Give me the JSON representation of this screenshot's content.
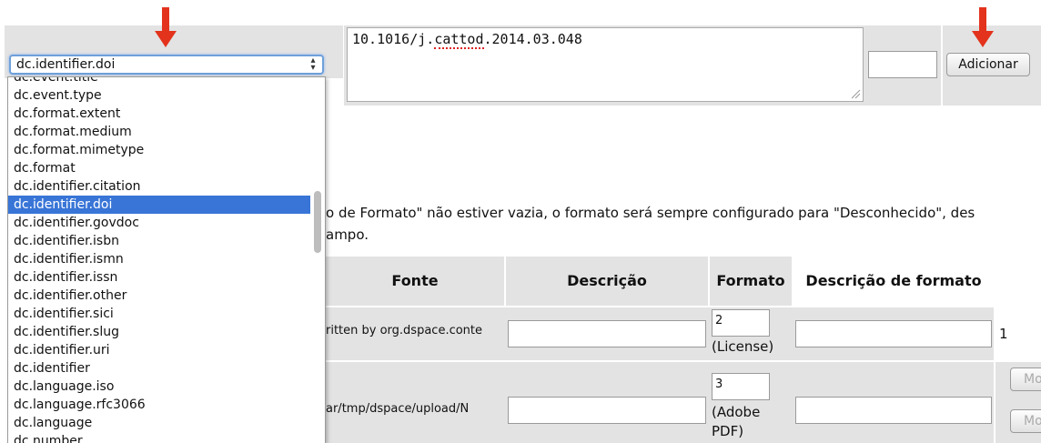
{
  "field_select": {
    "selected": "dc.identifier.doi",
    "options": [
      "dc.event.title",
      "dc.event.type",
      "dc.format.extent",
      "dc.format.medium",
      "dc.format.mimetype",
      "dc.format",
      "dc.identifier.citation",
      "dc.identifier.doi",
      "dc.identifier.govdoc",
      "dc.identifier.isbn",
      "dc.identifier.ismn",
      "dc.identifier.issn",
      "dc.identifier.other",
      "dc.identifier.sici",
      "dc.identifier.slug",
      "dc.identifier.uri",
      "dc.identifier",
      "dc.language.iso",
      "dc.language.rfc3066",
      "dc.language",
      "dc.number"
    ],
    "selected_index": 7
  },
  "value_text": {
    "prefix": "10.1016/j.",
    "misspelled": "cattod",
    "suffix": ".2014.03.048"
  },
  "add_button": "Adicionar",
  "notice": {
    "line1": "o de Formato\" não estiver vazia, o formato será sempre configurado para \"Desconhecido\", des",
    "line2": "ampo."
  },
  "table": {
    "headers": {
      "fonte": "Fonte",
      "descricao": "Descrição",
      "formato": "Formato",
      "descricao_formato": "Descrição de formato"
    },
    "rows": [
      {
        "fonte": "ritten by org.dspace.conte",
        "format_id": "2",
        "format_name": "(License)",
        "trailing": "1"
      },
      {
        "fonte": "ar/tmp/dspace/upload/N",
        "format_id": "3",
        "format_name": "(Adobe PDF)",
        "trailing": ""
      }
    ],
    "side_button_label": "Mo"
  },
  "colors": {
    "arrow": "#e3331c",
    "selection": "#3875d7",
    "panel_gray": "#e3e3e3"
  }
}
